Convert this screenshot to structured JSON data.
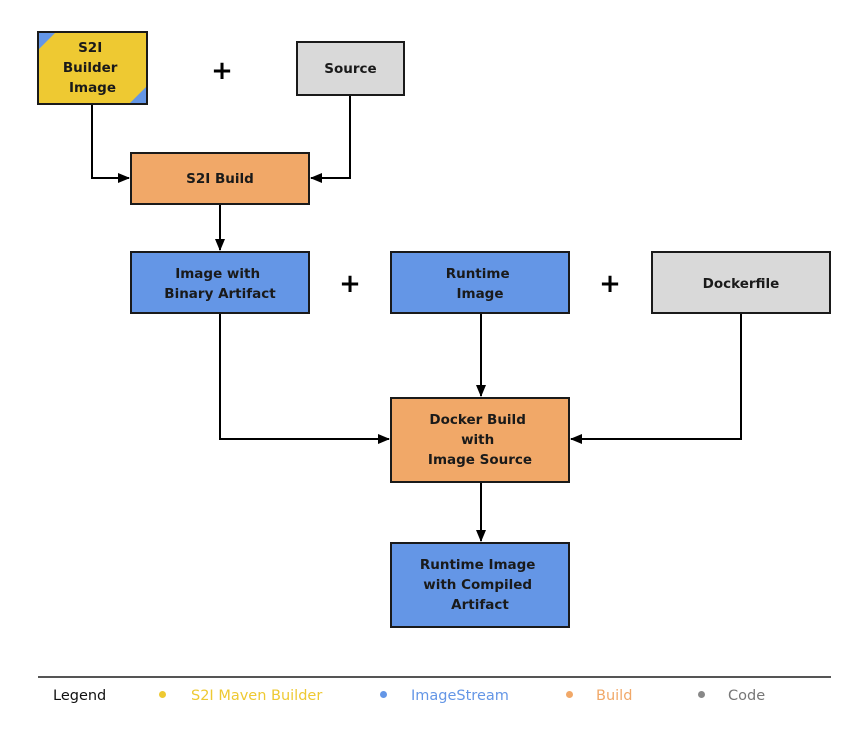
{
  "diagram": {
    "colors": {
      "builder": "#EEC932",
      "imagestream": "#6496E6",
      "build": "#F1A868",
      "code": "#D9D9D9",
      "stroke": "#1a1a1a"
    },
    "nodes": {
      "s2i_builder_image": {
        "lines": [
          "S2I",
          "Builder",
          "Image"
        ],
        "category": "builder"
      },
      "source": {
        "lines": [
          "Source"
        ],
        "category": "code"
      },
      "s2i_build": {
        "lines": [
          "S2I Build"
        ],
        "category": "build"
      },
      "image_with_binary_artifact": {
        "lines": [
          "Image with",
          "Binary Artifact"
        ],
        "category": "imagestream"
      },
      "runtime_image": {
        "lines": [
          "Runtime",
          "Image"
        ],
        "category": "imagestream"
      },
      "dockerfile": {
        "lines": [
          "Dockerfile"
        ],
        "category": "code"
      },
      "docker_build": {
        "lines": [
          "Docker Build",
          "with",
          "Image Source"
        ],
        "category": "build"
      },
      "runtime_image_compiled": {
        "lines": [
          "Runtime Image",
          "with Compiled",
          "Artifact"
        ],
        "category": "imagestream"
      }
    },
    "edges": [
      {
        "from": "s2i_builder_image",
        "to": "s2i_build"
      },
      {
        "from": "source",
        "to": "s2i_build"
      },
      {
        "from": "s2i_build",
        "to": "image_with_binary_artifact"
      },
      {
        "from": "image_with_binary_artifact",
        "to": "docker_build"
      },
      {
        "from": "runtime_image",
        "to": "docker_build"
      },
      {
        "from": "dockerfile",
        "to": "docker_build"
      },
      {
        "from": "docker_build",
        "to": "runtime_image_compiled"
      }
    ],
    "plus_symbol": "+"
  },
  "legend": {
    "title": "Legend",
    "items": [
      {
        "label": "S2I Maven Builder",
        "color": "#EEC932"
      },
      {
        "label": "ImageStream",
        "color": "#6496E6"
      },
      {
        "label": "Build",
        "color": "#F1A868"
      },
      {
        "label": "Code",
        "color": "#888888"
      }
    ]
  }
}
